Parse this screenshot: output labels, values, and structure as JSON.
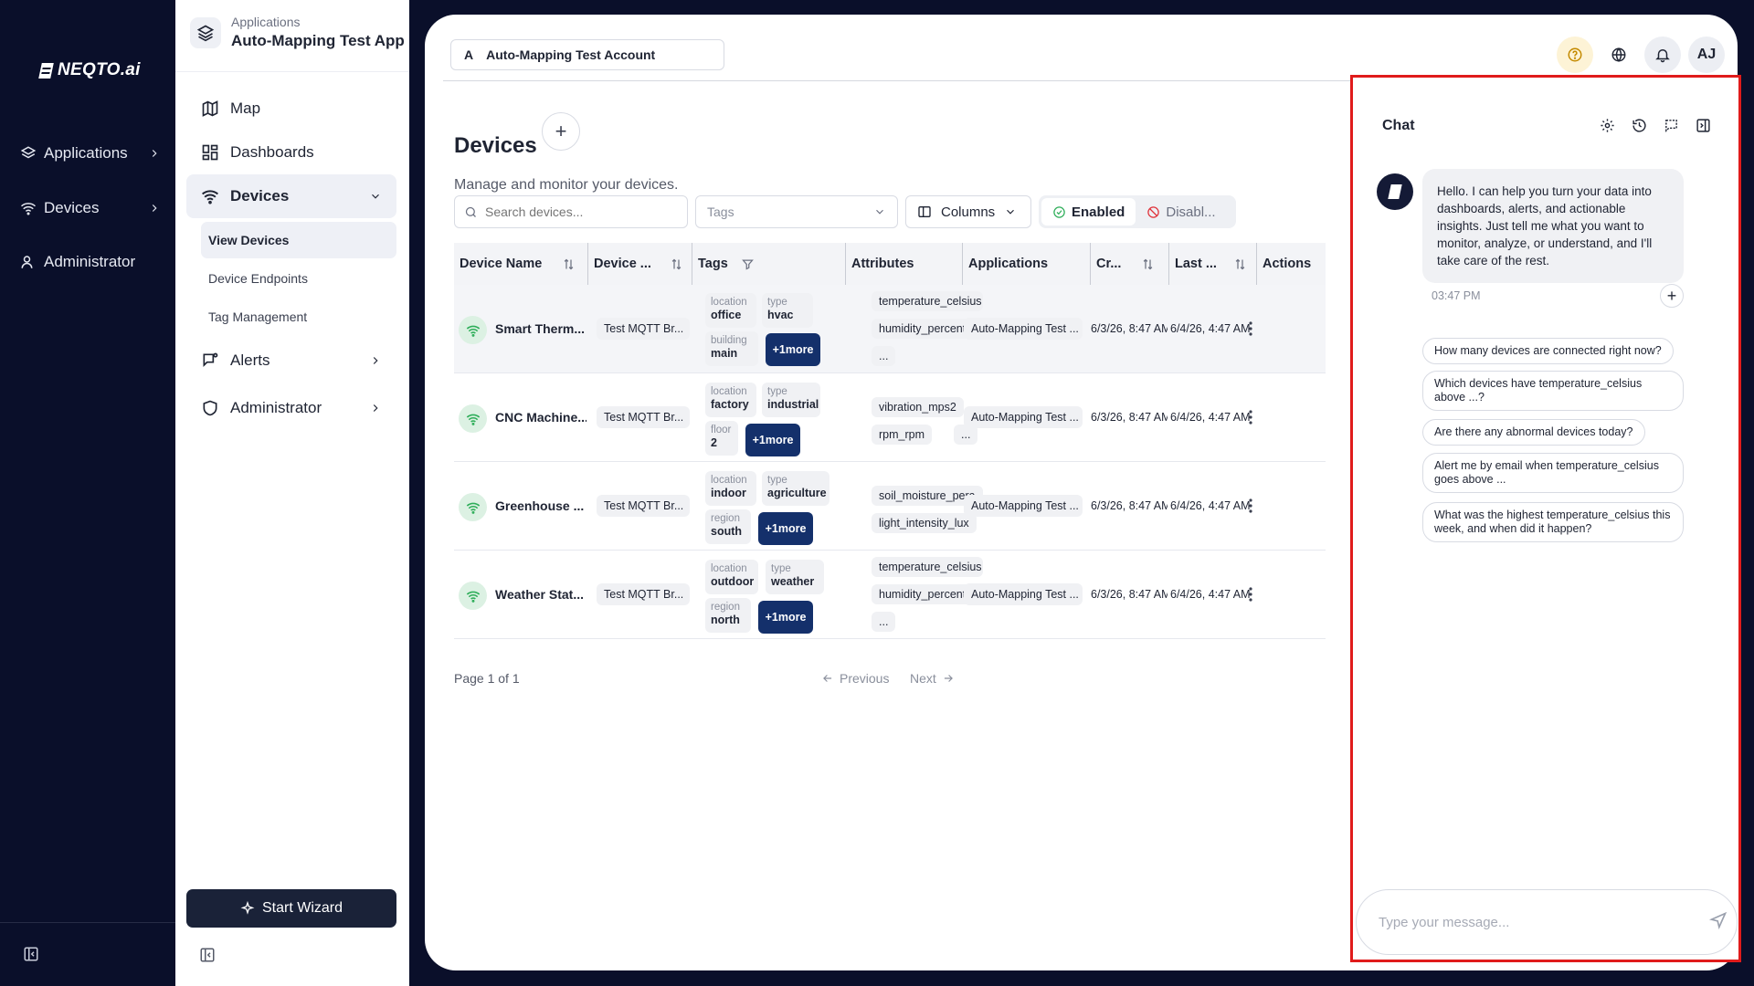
{
  "rail": {
    "logo": "NEQTO.ai",
    "items": [
      {
        "label": "Applications"
      },
      {
        "label": "Devices"
      },
      {
        "label": "Administrator"
      }
    ]
  },
  "sidebar": {
    "app_sub": "Applications",
    "app_name": "Auto-Mapping Test App",
    "nav": {
      "map": "Map",
      "dashboards": "Dashboards",
      "devices": "Devices",
      "alerts": "Alerts",
      "administrator": "Administrator"
    },
    "subnav": {
      "view_devices": "View Devices",
      "device_endpoints": "Device Endpoints",
      "tag_management": "Tag Management"
    },
    "wizard": "Start Wizard"
  },
  "header": {
    "account_initial": "A",
    "account_name": "Auto-Mapping Test Account",
    "avatar": "AJ"
  },
  "page": {
    "title": "Devices",
    "add": "+",
    "subtitle": "Manage and monitor your devices.",
    "search_placeholder": "Search devices...",
    "tags_placeholder": "Tags",
    "columns_label": "Columns",
    "enabled_label": "Enabled",
    "disabled_label": "Disabl..."
  },
  "table": {
    "headers": {
      "name": "Device Name",
      "device": "Device ...",
      "tags": "Tags",
      "attributes": "Attributes",
      "applications": "Applications",
      "created": "Cr...",
      "last": "Last ...",
      "actions": "Actions"
    },
    "rows": [
      {
        "name": "Smart Therm...",
        "endpoint": "Test MQTT Br...",
        "tag1_k": "location",
        "tag1_v": "office",
        "tag2_k": "type",
        "tag2_v": "hvac",
        "tag3_k": "building",
        "tag3_v": "main",
        "more": "+1more",
        "attr1": "temperature_celsius",
        "attr2": "humidity_percent",
        "attr3": "...",
        "app": "Auto-Mapping Test ...",
        "created": "6/3/26, 8:47 AM",
        "last": "6/4/26, 4:47 AM"
      },
      {
        "name": "CNC Machine...",
        "endpoint": "Test MQTT Br...",
        "tag1_k": "location",
        "tag1_v": "factory",
        "tag2_k": "type",
        "tag2_v": "industrial",
        "tag3_k": "floor",
        "tag3_v": "2",
        "more": "+1more",
        "attr1": "vibration_mps2",
        "attr2": "rpm_rpm",
        "attr3": "...",
        "app": "Auto-Mapping Test ...",
        "created": "6/3/26, 8:47 AM",
        "last": "6/4/26, 4:47 AM"
      },
      {
        "name": "Greenhouse ...",
        "endpoint": "Test MQTT Br...",
        "tag1_k": "location",
        "tag1_v": "indoor",
        "tag2_k": "type",
        "tag2_v": "agriculture",
        "tag3_k": "region",
        "tag3_v": "south",
        "more": "+1more",
        "attr1": "soil_moisture_perc...",
        "attr2": "light_intensity_lux",
        "app": "Auto-Mapping Test ...",
        "created": "6/3/26, 8:47 AM",
        "last": "6/4/26, 4:47 AM"
      },
      {
        "name": "Weather Stat...",
        "endpoint": "Test MQTT Br...",
        "tag1_k": "location",
        "tag1_v": "outdoor",
        "tag2_k": "type",
        "tag2_v": "weather",
        "tag3_k": "region",
        "tag3_v": "north",
        "more": "+1more",
        "attr1": "temperature_celsius",
        "attr2": "humidity_percent",
        "attr3": "...",
        "app": "Auto-Mapping Test ...",
        "created": "6/3/26, 8:47 AM",
        "last": "6/4/26, 4:47 AM"
      }
    ]
  },
  "pagination": {
    "info": "Page 1 of 1",
    "previous": "Previous",
    "next": "Next"
  },
  "chat": {
    "title": "Chat",
    "message": "Hello. I can help you turn your data into dashboards, alerts, and actionable insights. Just tell me what you want to monitor, analyze, or understand, and I'll take care of the rest.",
    "time": "03:47 PM",
    "plus": "+",
    "suggestions": [
      "How many devices are connected right now?",
      "Which devices have temperature_celsius above ...?",
      "Are there any abnormal devices today?",
      "Alert me by email when temperature_celsius goes above ...",
      "What was the highest temperature_celsius this week, and when did it happen?"
    ],
    "input_placeholder": "Type your message..."
  },
  "colors": {
    "rail_bg": "#0a0f2a",
    "wizard_bg": "#1a2238",
    "more_badge": "#14306b",
    "highlight_border": "#e01b1b",
    "online_green": "#2fae5a"
  },
  "icons": [
    "layers-icon",
    "wifi-icon",
    "user-icon",
    "map-icon",
    "dashboard-icon",
    "bell-alert-icon",
    "shield-icon",
    "sparkle-icon",
    "help-icon",
    "globe-icon",
    "bell-icon",
    "search-icon",
    "columns-icon",
    "check-circle-icon",
    "ban-icon",
    "sort-icon",
    "filter-icon",
    "kebab-icon",
    "settings-icon",
    "history-icon",
    "chat-new-icon",
    "panel-icon",
    "send-icon"
  ]
}
